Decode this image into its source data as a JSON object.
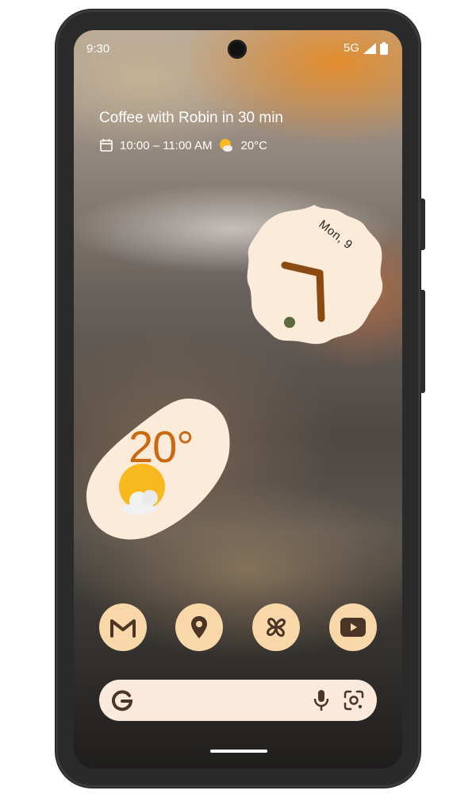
{
  "status_bar": {
    "time": "9:30",
    "network": "5G"
  },
  "glance": {
    "event_title": "Coffee with Robin in 30 min",
    "event_time": "10:00 – 11:00 AM",
    "temperature": "20°C",
    "icons": [
      "calendar-icon",
      "partly-sunny-icon"
    ]
  },
  "clock_widget": {
    "date": "Mon, 9",
    "hour_hand_color": "#8a4a12",
    "minute_hand_color": "#8a4a12",
    "dot_color": "#5b6b3a"
  },
  "weather_widget": {
    "temperature": "20°",
    "condition_icon": "sun-with-cloud-icon",
    "accent": "#c96a12"
  },
  "dock": {
    "apps": [
      {
        "name": "Gmail",
        "icon": "gmail-icon"
      },
      {
        "name": "Maps",
        "icon": "maps-pin-icon"
      },
      {
        "name": "Photos",
        "icon": "pinwheel-icon"
      },
      {
        "name": "YouTube",
        "icon": "youtube-icon"
      }
    ]
  },
  "search_bar": {
    "logo": "google-g-icon",
    "mic": "mic-icon",
    "lens": "lens-icon"
  },
  "colors": {
    "widget_bg": "#fcebd8",
    "dock_icon_bg": "#f8d7a8",
    "icon_fg": "#4a3526"
  }
}
